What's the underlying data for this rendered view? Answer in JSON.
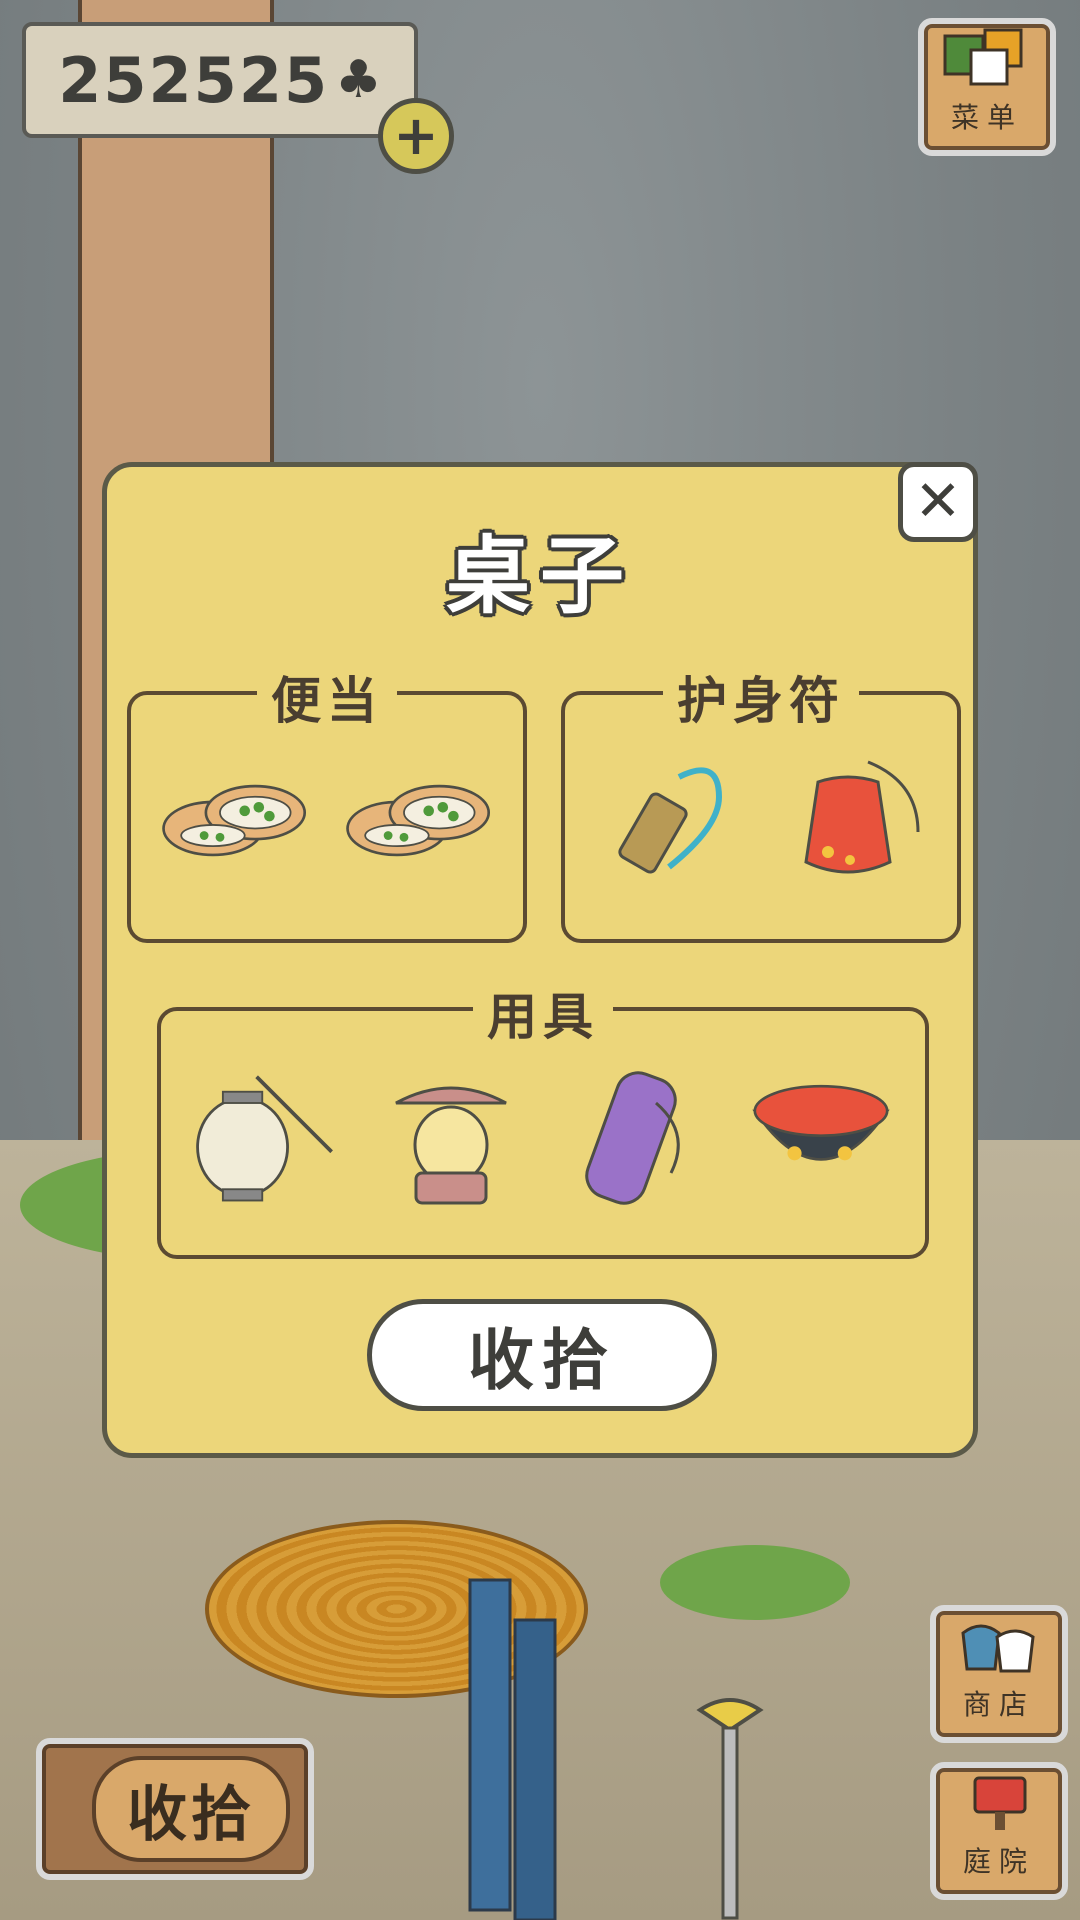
{
  "hud": {
    "clover_count": "252525",
    "clover_icon": "clover-icon",
    "add_icon": "plus-icon"
  },
  "side_buttons": {
    "menu_label": "菜单",
    "shop_label": "商店",
    "garden_label": "庭院"
  },
  "bottom": {
    "collect_label": "收拾"
  },
  "dialog": {
    "title": "桌子",
    "close_icon": "close-icon",
    "sections": {
      "bento": {
        "label": "便当",
        "items": [
          "bun-sandwich-icon",
          "bun-sandwich-icon"
        ]
      },
      "charm": {
        "label": "护身符",
        "items": [
          "bell-charm-icon",
          "red-pouch-charm-icon"
        ]
      },
      "tools": {
        "label": "用具",
        "items": [
          "paper-lantern-icon",
          "oil-lamp-icon",
          "purple-bottle-bag-icon",
          "red-bowl-icon"
        ]
      }
    },
    "collect_button": "收拾"
  },
  "colors": {
    "dialog_bg": "#ecd67a",
    "outline": "#4e4e45",
    "accent_red": "#e8523c"
  }
}
